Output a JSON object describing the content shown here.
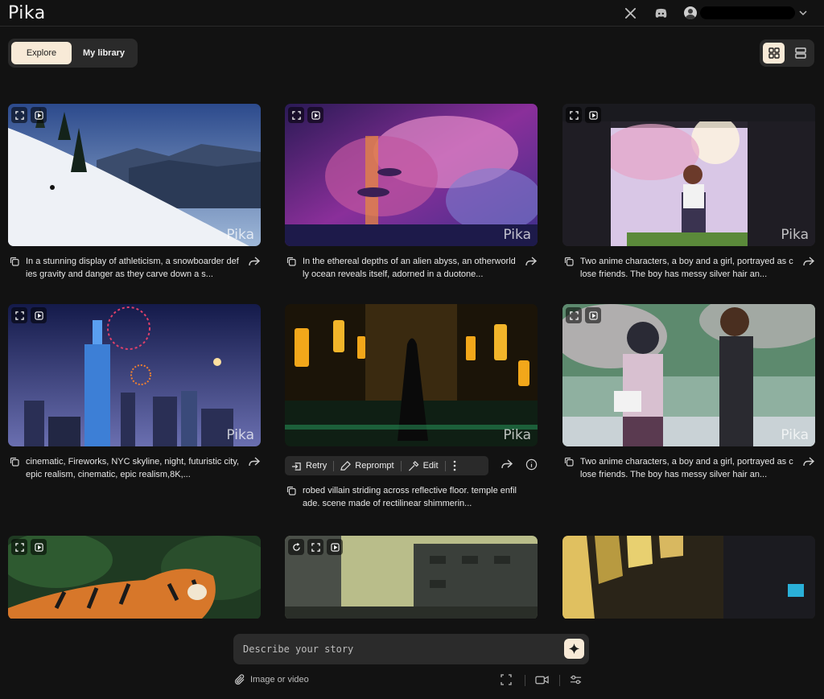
{
  "app": {
    "logo": "Pika"
  },
  "header": {
    "icons": [
      "x-logo-icon",
      "discord-icon",
      "user-avatar-icon",
      "chevron-down-icon"
    ]
  },
  "tabs": [
    {
      "label": "Explore",
      "active": true
    },
    {
      "label": "My library",
      "active": false
    }
  ],
  "view_toggle": {
    "selected": "grid",
    "options": [
      "grid-view-icon",
      "list-view-icon"
    ]
  },
  "watermark": "Pika",
  "cards": [
    {
      "caption": "In a stunning display of athleticism, a snowboarder defies gravity and danger as they carve down a s..."
    },
    {
      "caption": "In the ethereal depths of an alien abyss, an otherworldly ocean reveals itself, adorned in a duotone..."
    },
    {
      "caption": "Two anime characters, a boy and a girl, portrayed as close friends. The boy has messy silver hair an..."
    },
    {
      "caption": "cinematic, Fireworks, NYC skyline, night, futuristic city, epic realism, cinematic, epic realism,8K,..."
    },
    {
      "caption": "robed villain striding across reflective floor. temple enfilade. scene made of rectilinear shimmerin..."
    },
    {
      "caption": "Two anime characters, a boy and a girl, portrayed as close friends. The boy has messy silver hair an..."
    }
  ],
  "hover_actions": {
    "retry": "Retry",
    "reprompt": "Reprompt",
    "edit": "Edit"
  },
  "prompt": {
    "placeholder": "Describe your story",
    "value": "",
    "upload_label": "Image or video"
  },
  "colors": {
    "background": "#121212",
    "accent": "#f8ead7",
    "panel": "#2a2a2a"
  }
}
